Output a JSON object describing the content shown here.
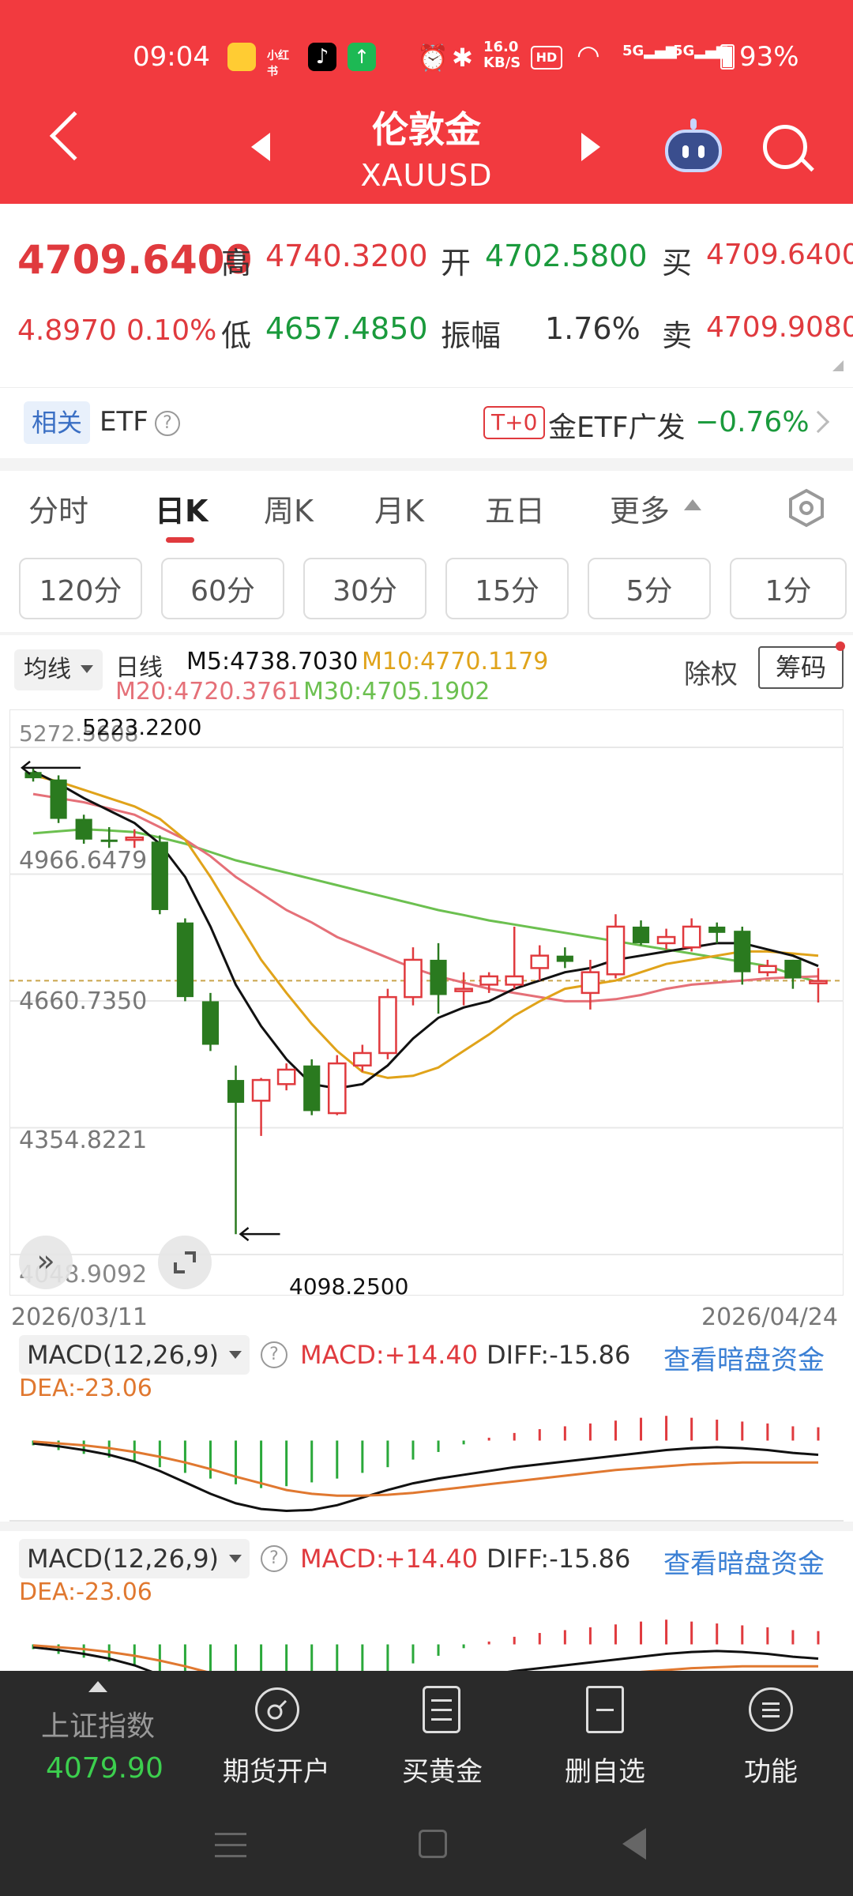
{
  "status": {
    "time": "09:04",
    "network": "16.0\nKB/S",
    "battery": "93%"
  },
  "header": {
    "title": "伦敦金",
    "symbol": "XAUUSD"
  },
  "quote": {
    "price": "4709.6400",
    "change": "4.8970",
    "change_pct": "0.10%",
    "high_label": "高",
    "high": "4740.3200",
    "open_label": "开",
    "open": "4702.5800",
    "buy_label": "买",
    "buy": "4709.6400",
    "low_label": "低",
    "low": "4657.4850",
    "amp_label": "振幅",
    "amp": "1.76%",
    "sell_label": "卖",
    "sell": "4709.9080"
  },
  "etf": {
    "tag": "相关",
    "label": "ETF",
    "badge": "T+0",
    "name": "金ETF广发",
    "change": "−0.76%"
  },
  "tabs": [
    "分时",
    "日K",
    "周K",
    "月K",
    "五日",
    "更多"
  ],
  "intervals": [
    "120分",
    "60分",
    "30分",
    "15分",
    "5分",
    "1分"
  ],
  "chart_legend": {
    "ma_select": "均线",
    "period": "日线",
    "m5": "M5:4738.7030",
    "m10": "M10:4770.1179",
    "m20": "M20:4720.3761",
    "m30": "M30:4705.1902",
    "exright": "除权",
    "chips": "筹码"
  },
  "chart_data": {
    "type": "candlestick",
    "y_ticks": [
      "5272.5608",
      "4966.6479",
      "4660.7350",
      "4354.8221",
      "4048.9092"
    ],
    "ylim": [
      4048.9092,
      5272.5608
    ],
    "high_marker": "5223.2200",
    "low_marker": "4098.2500",
    "date_start": "2026/03/11",
    "date_end": "2026/04/24",
    "candles": [
      [
        5213,
        5225,
        5190,
        5198
      ],
      [
        5195,
        5205,
        5090,
        5100
      ],
      [
        5100,
        5110,
        5040,
        5050
      ],
      [
        5050,
        5080,
        5030,
        5048
      ],
      [
        5050,
        5075,
        5030,
        5055
      ],
      [
        5045,
        5060,
        4870,
        4880
      ],
      [
        4850,
        4860,
        4660,
        4670
      ],
      [
        4660,
        4680,
        4540,
        4555
      ],
      [
        4470,
        4505,
        4098,
        4415
      ],
      [
        4420,
        4475,
        4335,
        4470
      ],
      [
        4460,
        4510,
        4445,
        4495
      ],
      [
        4505,
        4520,
        4385,
        4395
      ],
      [
        4390,
        4530,
        4385,
        4510
      ],
      [
        4505,
        4555,
        4490,
        4535
      ],
      [
        4535,
        4690,
        4520,
        4670
      ],
      [
        4670,
        4790,
        4650,
        4760
      ],
      [
        4760,
        4800,
        4630,
        4675
      ],
      [
        4690,
        4730,
        4650,
        4690
      ],
      [
        4700,
        4730,
        4680,
        4720
      ],
      [
        4700,
        4840,
        4690,
        4720
      ],
      [
        4740,
        4795,
        4710,
        4770
      ],
      [
        4770,
        4790,
        4740,
        4755
      ],
      [
        4680,
        4760,
        4640,
        4730
      ],
      [
        4725,
        4870,
        4715,
        4840
      ],
      [
        4840,
        4855,
        4795,
        4800
      ],
      [
        4800,
        4835,
        4785,
        4815
      ],
      [
        4790,
        4860,
        4780,
        4840
      ],
      [
        4840,
        4850,
        4800,
        4825
      ],
      [
        4830,
        4840,
        4700,
        4730
      ],
      [
        4730,
        4760,
        4720,
        4745
      ],
      [
        4760,
        4760,
        4690,
        4715
      ],
      [
        4705,
        4740,
        4657,
        4709
      ]
    ],
    "ma5": [
      5215,
      5185,
      5150,
      5120,
      5090,
      5040,
      4960,
      4840,
      4700,
      4600,
      4520,
      4460,
      4450,
      4460,
      4505,
      4570,
      4620,
      4645,
      4660,
      4690,
      4710,
      4730,
      4740,
      4760,
      4770,
      4780,
      4790,
      4800,
      4800,
      4785,
      4770,
      4745
    ],
    "ma10": [
      5205,
      5190,
      5170,
      5150,
      5130,
      5100,
      5050,
      4960,
      4860,
      4760,
      4680,
      4605,
      4540,
      4490,
      4475,
      4480,
      4500,
      4540,
      4580,
      4625,
      4660,
      4690,
      4700,
      4710,
      4730,
      4750,
      4760,
      4770,
      4780,
      4780,
      4775,
      4770
    ],
    "ma20": [
      5160,
      5150,
      5140,
      5125,
      5110,
      5080,
      5050,
      5010,
      4960,
      4920,
      4880,
      4850,
      4815,
      4790,
      4765,
      4740,
      4720,
      4705,
      4690,
      4680,
      4670,
      4660,
      4660,
      4665,
      4675,
      4690,
      4700,
      4705,
      4710,
      4715,
      4718,
      4720
    ],
    "ma30": [
      5065,
      5070,
      5075,
      5072,
      5068,
      5055,
      5040,
      5020,
      5000,
      4985,
      4970,
      4955,
      4940,
      4925,
      4910,
      4895,
      4880,
      4868,
      4855,
      4845,
      4835,
      4825,
      4815,
      4805,
      4795,
      4785,
      4775,
      4765,
      4755,
      4745,
      4725,
      4705
    ]
  },
  "macd_panels": [
    {
      "select": "MACD(12,26,9)",
      "macd": "MACD:+14.40",
      "diff": "DIFF:-15.86",
      "link": "查看暗盘资金",
      "dea": "DEA:-23.06"
    },
    {
      "select": "MACD(12,26,9)",
      "macd": "MACD:+14.40",
      "diff": "DIFF:-15.86",
      "link": "查看暗盘资金",
      "dea": "DEA:-23.06"
    }
  ],
  "macd_data": {
    "hist": [
      -5,
      -10,
      -14,
      -18,
      -22,
      -28,
      -34,
      -40,
      -46,
      -50,
      -48,
      -44,
      -40,
      -34,
      -28,
      -20,
      -12,
      -4,
      3,
      8,
      12,
      15,
      18,
      21,
      24,
      26,
      24,
      22,
      20,
      18,
      15,
      14
    ],
    "diff": [
      -3,
      -6,
      -10,
      -15,
      -22,
      -32,
      -44,
      -56,
      -66,
      -72,
      -74,
      -73,
      -68,
      -60,
      -52,
      -45,
      -40,
      -36,
      -32,
      -28,
      -25,
      -22,
      -19,
      -16,
      -13,
      -10,
      -8,
      -7,
      -8,
      -10,
      -13,
      -15
    ],
    "dea": [
      -1,
      -3,
      -5,
      -8,
      -12,
      -17,
      -23,
      -30,
      -38,
      -45,
      -52,
      -56,
      -58,
      -58,
      -57,
      -55,
      -52,
      -49,
      -46,
      -43,
      -40,
      -37,
      -34,
      -31,
      -29,
      -27,
      -25,
      -24,
      -23,
      -23,
      -23,
      -23
    ]
  },
  "bottom_bar": {
    "index_name": "上证指数",
    "index_value": "4079.90",
    "items": [
      "期货开户",
      "买黄金",
      "删自选",
      "功能"
    ]
  },
  "colors": {
    "header_red": "#f23a3f",
    "up": "#e03a3e",
    "down": "#2a7a1f",
    "ma5": "#111111",
    "ma10": "#e0a31a",
    "ma20": "#e57078",
    "ma30": "#6cc050"
  }
}
